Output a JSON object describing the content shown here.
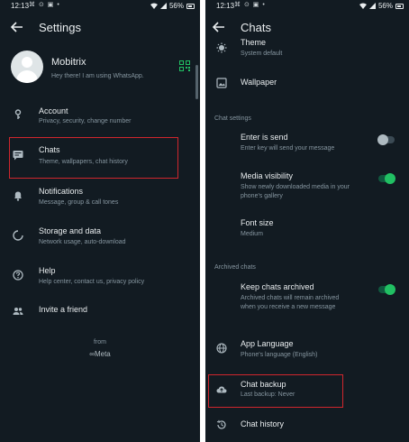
{
  "left": {
    "status": {
      "time": "12:13",
      "icons": "⌘ ⊙ ▣ •",
      "battery": "56%"
    },
    "header": {
      "title": "Settings"
    },
    "profile": {
      "name": "Mobitrix",
      "status": "Hey there! I am using WhatsApp."
    },
    "items": [
      {
        "title": "Account",
        "subtitle": "Privacy, security, change number"
      },
      {
        "title": "Chats",
        "subtitle": "Theme, wallpapers, chat history"
      },
      {
        "title": "Notifications",
        "subtitle": "Message, group & call tones"
      },
      {
        "title": "Storage and data",
        "subtitle": "Network usage, auto-download"
      },
      {
        "title": "Help",
        "subtitle": "Help center, contact us, privacy policy"
      },
      {
        "title": "Invite a friend",
        "subtitle": ""
      }
    ],
    "footer": {
      "from": "from",
      "brand": "∞Meta"
    }
  },
  "right": {
    "status": {
      "time": "12:13",
      "icons": "⌘ ⊙ ▣ •",
      "battery": "56%"
    },
    "header": {
      "title": "Chats"
    },
    "theme": {
      "title": "Theme",
      "subtitle": "System default"
    },
    "wallpaper": {
      "title": "Wallpaper"
    },
    "sections": {
      "chat_settings": "Chat settings",
      "archived_chats": "Archived chats"
    },
    "enter_is_send": {
      "title": "Enter is send",
      "subtitle": "Enter key will send your message",
      "enabled": false
    },
    "media_visibility": {
      "title": "Media visibility",
      "subtitle_1": "Show newly downloaded media in your",
      "subtitle_2": "phone's gallery",
      "enabled": true
    },
    "font_size": {
      "title": "Font size",
      "subtitle": "Medium"
    },
    "keep_archived": {
      "title": "Keep chats archived",
      "subtitle_1": "Archived chats will remain archived",
      "subtitle_2": "when you receive a new message",
      "enabled": true
    },
    "app_language": {
      "title": "App Language",
      "subtitle": "Phone's language (English)"
    },
    "chat_backup": {
      "title": "Chat backup",
      "subtitle": "Last backup: Never"
    },
    "chat_history": {
      "title": "Chat history"
    }
  },
  "colors": {
    "background": "#121b22",
    "accent": "#21c063",
    "highlight": "#d0262d",
    "primary_text": "#e9edef",
    "secondary_text": "#8696a0"
  },
  "icons": [
    "back-arrow-icon",
    "qr-code-icon",
    "key-icon",
    "chat-icon",
    "bell-icon",
    "storage-icon",
    "help-icon",
    "people-icon",
    "theme-icon",
    "wallpaper-icon",
    "globe-icon",
    "cloud-upload-icon",
    "history-icon"
  ]
}
